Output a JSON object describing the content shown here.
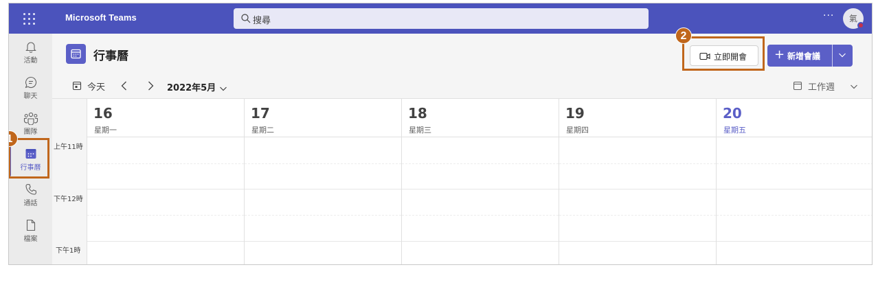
{
  "topbar": {
    "app_title": "Microsoft Teams",
    "search_placeholder": "搜尋",
    "more_label": "···",
    "avatar_text": "氣"
  },
  "rail": {
    "items": [
      {
        "label": "活動",
        "icon": "bell-icon"
      },
      {
        "label": "聊天",
        "icon": "chat-icon"
      },
      {
        "label": "團隊",
        "icon": "teams-icon"
      },
      {
        "label": "行事曆",
        "icon": "calendar-icon",
        "active": true
      },
      {
        "label": "通話",
        "icon": "phone-icon"
      },
      {
        "label": "檔案",
        "icon": "file-icon"
      }
    ]
  },
  "header": {
    "title": "行事曆",
    "meet_now_label": "立即開會",
    "new_meeting_label": "新增會議"
  },
  "toolbar": {
    "today_label": "今天",
    "month_label": "2022年5月",
    "view_label": "工作週"
  },
  "calendar": {
    "days": [
      {
        "num": "16",
        "name": "星期一"
      },
      {
        "num": "17",
        "name": "星期二"
      },
      {
        "num": "18",
        "name": "星期三"
      },
      {
        "num": "19",
        "name": "星期四"
      },
      {
        "num": "20",
        "name": "星期五",
        "today": true
      }
    ],
    "time_labels": [
      "上午11時",
      "下午12時",
      "下午1時"
    ]
  },
  "callouts": [
    "1",
    "2"
  ],
  "colors": {
    "topbar": "#4b53bc",
    "accent": "#5b5fc7",
    "callout": "#c0661b"
  }
}
